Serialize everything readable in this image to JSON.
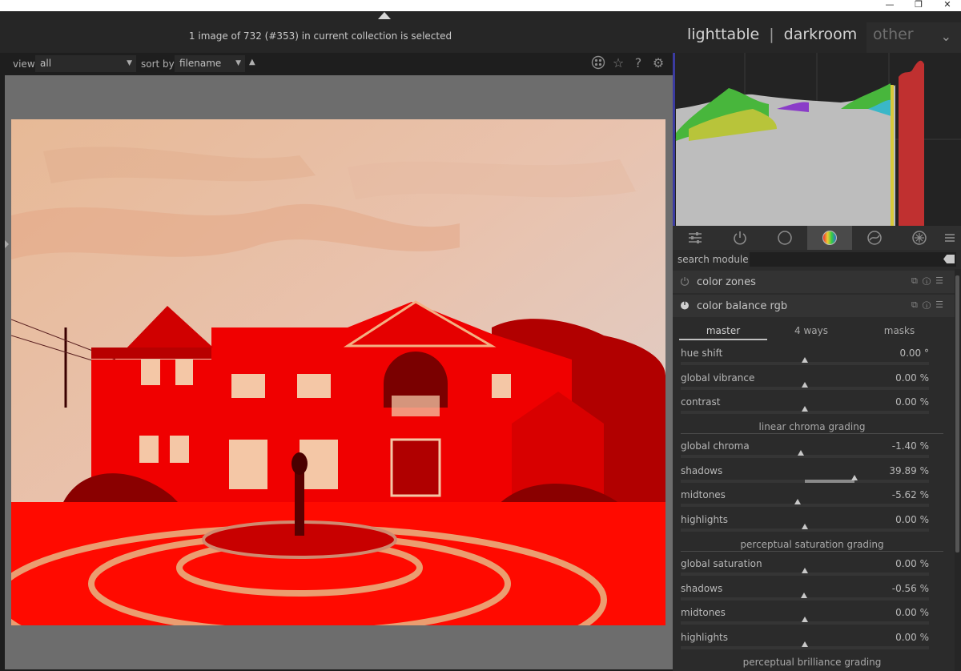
{
  "window": {
    "minimize": "—",
    "restore": "❐",
    "close": "✕"
  },
  "header": {
    "collection_message": "1 image of 732 (#353) in current collection is selected",
    "views": [
      "lighttable",
      "darkroom",
      "other"
    ],
    "separator": "|"
  },
  "filter_bar": {
    "view_label": "view",
    "view_value": "all",
    "sort_label": "sort by",
    "sort_value": "filename",
    "sort_direction": "▲",
    "icons": [
      "grouping-icon",
      "star-icon",
      "help-icon",
      "gear-icon"
    ],
    "help_glyph": "?"
  },
  "module_tabs": {
    "icons": [
      "sliders-icon",
      "power-icon",
      "circle-icon",
      "color-wheel-icon",
      "correct-icon",
      "effect-icon",
      "menu-icon"
    ],
    "active_index": 3
  },
  "search": {
    "label": "search module",
    "value": ""
  },
  "modules": [
    {
      "name": "color zones",
      "enabled": false
    },
    {
      "name": "color balance rgb",
      "enabled": true
    }
  ],
  "color_balance": {
    "tabs": [
      "master",
      "4 ways",
      "masks"
    ],
    "active_tab": "master",
    "sliders": [
      {
        "label": "hue shift",
        "value": "0.00 °",
        "pos": 0.5
      },
      {
        "label": "global vibrance",
        "value": "0.00 %",
        "pos": 0.5
      },
      {
        "label": "contrast",
        "value": "0.00 %",
        "pos": 0.5
      }
    ],
    "section_linear": "linear chroma grading",
    "linear_sliders": [
      {
        "label": "global chroma",
        "value": "-1.40 %",
        "pos": 0.485
      },
      {
        "label": "shadows",
        "value": "39.89 %",
        "pos": 0.7,
        "fill_from": 0.5
      },
      {
        "label": "midtones",
        "value": "-5.62 %",
        "pos": 0.47
      },
      {
        "label": "highlights",
        "value": "0.00 %",
        "pos": 0.5
      }
    ],
    "section_perceptual": "perceptual saturation grading",
    "perceptual_sliders": [
      {
        "label": "global saturation",
        "value": "0.00 %",
        "pos": 0.5
      },
      {
        "label": "shadows",
        "value": "-0.56 %",
        "pos": 0.497
      },
      {
        "label": "midtones",
        "value": "0.00 %",
        "pos": 0.5
      },
      {
        "label": "highlights",
        "value": "0.00 %",
        "pos": 0.5
      }
    ],
    "section_brilliance": "perceptual brilliance grading"
  },
  "colors": {
    "image_red": "#e10000",
    "sky": "#e8c0a6",
    "active_tab_bg": "#4a4a4a"
  }
}
